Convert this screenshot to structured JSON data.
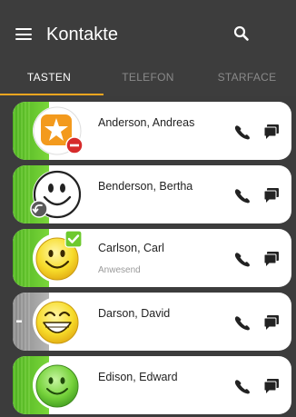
{
  "header": {
    "title": "Kontakte",
    "menu_icon": "hamburger-menu-icon",
    "search_icon": "search-icon"
  },
  "tabs": [
    {
      "label": "TASTEN",
      "active": true
    },
    {
      "label": "TELEFON",
      "active": false
    },
    {
      "label": "STARFACE",
      "active": false
    }
  ],
  "colors": {
    "accent": "#f2a51f",
    "appbar": "#3d3d3d",
    "available_green": "#6dc92d",
    "offline_gray": "#9a9a9a",
    "dnd_red": "#d62b2b"
  },
  "contacts": [
    {
      "name": "Anderson, Andreas",
      "status_text": "",
      "avatar": "starface-logo-icon",
      "badge": "do-not-disturb-icon",
      "status_color": "green"
    },
    {
      "name": "Benderson, Bertha",
      "status_text": "",
      "avatar": "smiley-outline-icon",
      "badge": "call-forward-icon",
      "status_color": "green"
    },
    {
      "name": "Carlson, Carl",
      "status_text": "Anwesend",
      "avatar": "smiley-yellow-icon",
      "badge": "checkmark-icon",
      "status_color": "green"
    },
    {
      "name": "Darson, David",
      "status_text": "",
      "avatar": "grin-smiley-icon",
      "badge": "",
      "status_color": "gray"
    },
    {
      "name": "Edison, Edward",
      "status_text": "",
      "avatar": "smiley-green-icon",
      "badge": "",
      "status_color": "green"
    }
  ],
  "actions": {
    "call_icon": "phone-call-icon",
    "chat_icon": "chat-bubble-icon"
  }
}
